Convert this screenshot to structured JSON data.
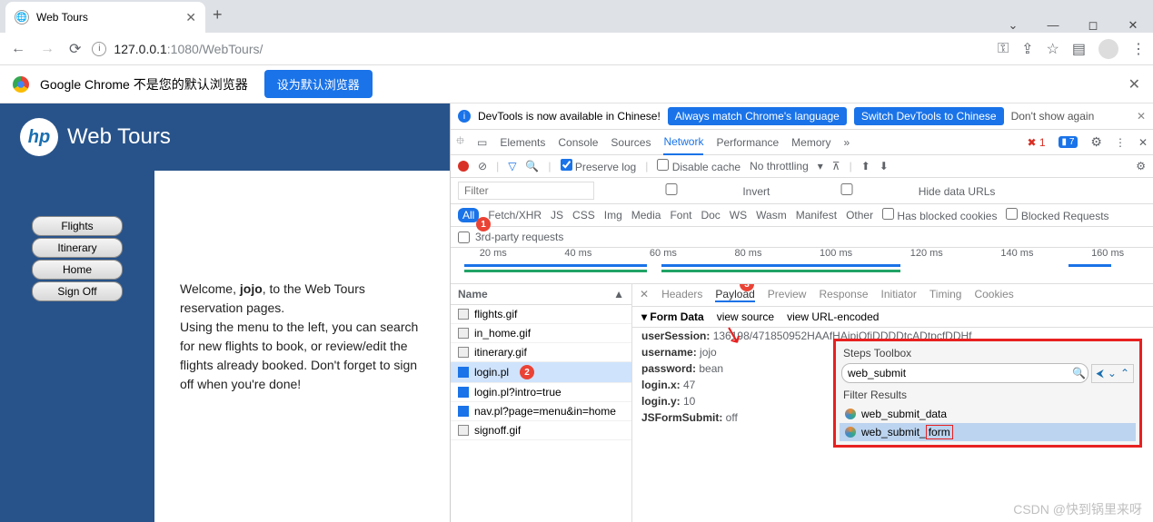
{
  "chrome": {
    "tab_title": "Web Tours",
    "url_host": "127.0.0.1",
    "url_port_path": ":1080/WebTours/",
    "infobar_text": "Google Chrome 不是您的默认浏览器",
    "infobar_button": "设为默认浏览器"
  },
  "app": {
    "logo_text": "Web Tours",
    "menu": [
      "Flights",
      "Itinerary",
      "Home",
      "Sign Off"
    ],
    "welcome_pre": "Welcome, ",
    "welcome_user": "jojo",
    "welcome_post": ", to the Web Tours reservation pages.",
    "body_text": "Using the menu to the left, you can search for new flights to book, or review/edit the flights already booked. Don't forget to sign off when you're done!"
  },
  "devtools": {
    "banner_text": "DevTools is now available in Chinese!",
    "banner_btn1": "Always match Chrome's language",
    "banner_btn2": "Switch DevTools to Chinese",
    "banner_link": "Don't show again",
    "tabs": [
      "Elements",
      "Console",
      "Sources",
      "Network",
      "Performance",
      "Memory"
    ],
    "active_tab": "Network",
    "error_count": "1",
    "warn_count": "7",
    "preserve_log": "Preserve log",
    "disable_cache": "Disable cache",
    "throttling": "No throttling",
    "filter_placeholder": "Filter",
    "invert": "Invert",
    "hide_urls": "Hide data URLs",
    "types": [
      "All",
      "Fetch/XHR",
      "JS",
      "CSS",
      "Img",
      "Media",
      "Font",
      "Doc",
      "WS",
      "Wasm",
      "Manifest",
      "Other"
    ],
    "has_blocked": "Has blocked cookies",
    "blocked_req": "Blocked Requests",
    "third_party": "3rd-party requests",
    "timeline_ticks": [
      "20 ms",
      "40 ms",
      "60 ms",
      "80 ms",
      "100 ms",
      "120 ms",
      "140 ms",
      "160 ms"
    ],
    "name_header": "Name",
    "requests": [
      {
        "name": "flights.gif",
        "type": "img"
      },
      {
        "name": "in_home.gif",
        "type": "img"
      },
      {
        "name": "itinerary.gif",
        "type": "img"
      },
      {
        "name": "login.pl",
        "type": "doc",
        "selected": true
      },
      {
        "name": "login.pl?intro=true",
        "type": "doc"
      },
      {
        "name": "nav.pl?page=menu&in=home",
        "type": "doc"
      },
      {
        "name": "signoff.gif",
        "type": "img"
      }
    ],
    "detail_tabs": [
      "Headers",
      "Payload",
      "Preview",
      "Response",
      "Initiator",
      "Timing",
      "Cookies"
    ],
    "detail_active": "Payload",
    "form_data_label": "Form Data",
    "view_source": "view source",
    "view_url": "view URL-encoded",
    "form": [
      {
        "k": "userSession:",
        "v": "136198/471850952HAAfHAipiQfiDDDDtcADtpcfDDHf"
      },
      {
        "k": "username:",
        "v": "jojo"
      },
      {
        "k": "password:",
        "v": "bean"
      },
      {
        "k": "login.x:",
        "v": "47"
      },
      {
        "k": "login.y:",
        "v": "10"
      },
      {
        "k": "JSFormSubmit:",
        "v": "off"
      }
    ]
  },
  "steps": {
    "title": "Steps Toolbox",
    "search": "web_submit",
    "filter_label": "Filter Results",
    "items": [
      "web_submit_data",
      "web_submit_form"
    ],
    "selected": "web_submit_form"
  },
  "annotations": {
    "b1": "1",
    "b2": "2",
    "b3": "3"
  },
  "watermark": "CSDN @快到锅里来呀"
}
